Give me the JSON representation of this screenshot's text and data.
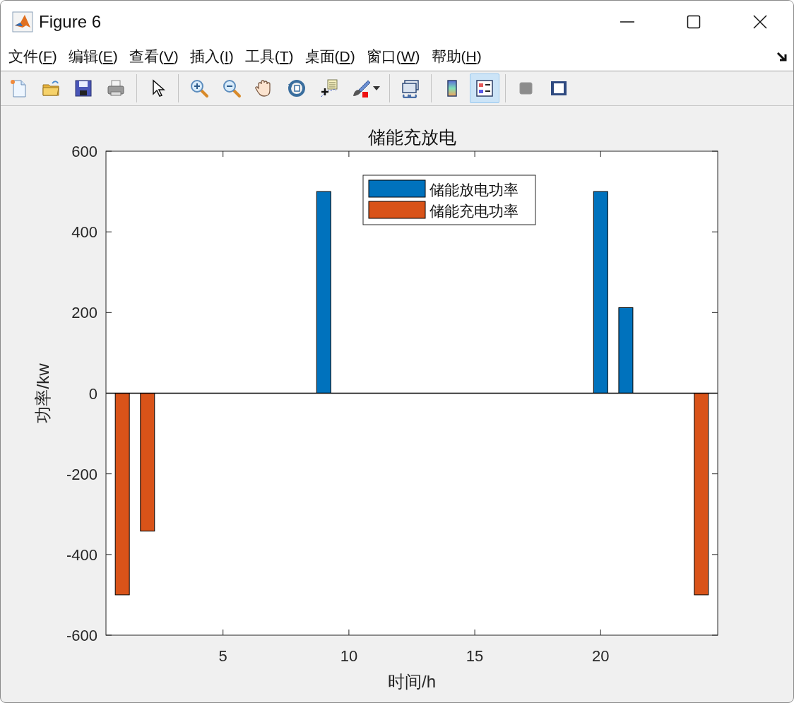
{
  "window": {
    "title": "Figure 6"
  },
  "menu": [
    {
      "before": "文件(",
      "key": "F",
      "after": ")"
    },
    {
      "before": "编辑(",
      "key": "E",
      "after": ")"
    },
    {
      "before": "查看(",
      "key": "V",
      "after": ")"
    },
    {
      "before": "插入(",
      "key": "I",
      "after": ")"
    },
    {
      "before": "工具(",
      "key": "T",
      "after": ")"
    },
    {
      "before": "桌面(",
      "key": "D",
      "after": ")"
    },
    {
      "before": "窗口(",
      "key": "W",
      "after": ")"
    },
    {
      "before": "帮助(",
      "key": "H",
      "after": ")"
    }
  ],
  "toolbar": {
    "groups": [
      [
        {
          "kind": "new",
          "selected": false
        },
        {
          "kind": "open",
          "selected": false
        },
        {
          "kind": "save",
          "selected": false
        },
        {
          "kind": "print",
          "selected": false
        }
      ],
      [
        {
          "kind": "pointer",
          "selected": false
        }
      ],
      [
        {
          "kind": "zoom-in",
          "selected": false
        },
        {
          "kind": "zoom-out",
          "selected": false
        },
        {
          "kind": "pan",
          "selected": false
        },
        {
          "kind": "rotate",
          "selected": false
        },
        {
          "kind": "data-cursor",
          "selected": false
        },
        {
          "kind": "brush",
          "selected": false
        }
      ],
      [
        {
          "kind": "link",
          "selected": false
        }
      ],
      [
        {
          "kind": "colorbar",
          "selected": false
        },
        {
          "kind": "legend",
          "selected": true
        }
      ],
      [
        {
          "kind": "hide-tools",
          "selected": false
        },
        {
          "kind": "show-tools",
          "selected": false
        }
      ]
    ]
  },
  "figure": {
    "chart_data": {
      "type": "bar",
      "stacked": true,
      "title": "储能充放电",
      "xlabel": "时间/h",
      "ylabel": "功率/kw",
      "x": [
        1,
        2,
        3,
        4,
        5,
        6,
        7,
        8,
        9,
        10,
        11,
        12,
        13,
        14,
        15,
        16,
        17,
        18,
        19,
        20,
        21,
        22,
        23,
        24
      ],
      "legend": true,
      "series": [
        {
          "name": "储能放电功率",
          "color": "#0072bd",
          "values": [
            0,
            0,
            0,
            0,
            0,
            0,
            0,
            0,
            500,
            0,
            0,
            0,
            0,
            0,
            0,
            0,
            0,
            0,
            0,
            500,
            212,
            0,
            0,
            0
          ]
        },
        {
          "name": "储能充电功率",
          "color": "#d95319",
          "values": [
            -500,
            -342,
            0,
            0,
            0,
            0,
            0,
            0,
            0,
            0,
            0,
            0,
            0,
            0,
            0,
            0,
            0,
            0,
            0,
            0,
            0,
            0,
            0,
            -500
          ]
        }
      ],
      "xlim": [
        0.35,
        24.65
      ],
      "ylim": [
        -600,
        600
      ],
      "xticks": [
        5,
        10,
        15,
        20
      ],
      "yticks": [
        -600,
        -400,
        -200,
        0,
        200,
        400,
        600
      ]
    }
  }
}
